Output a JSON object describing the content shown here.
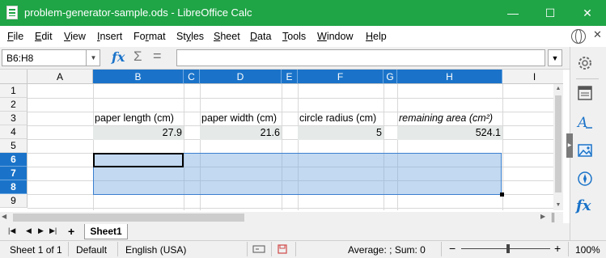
{
  "window": {
    "title": "problem-generator-sample.ods - LibreOffice Calc",
    "minimize": "—",
    "maximize": "☐",
    "close": "✕"
  },
  "menu": {
    "items": [
      {
        "label": "File",
        "accel": "F",
        "rest": "ile"
      },
      {
        "label": "Edit",
        "accel": "E",
        "rest": "dit"
      },
      {
        "label": "View",
        "accel": "V",
        "rest": "iew"
      },
      {
        "label": "Insert",
        "accel": "I",
        "rest": "nsert"
      },
      {
        "label": "Format",
        "accel": "F",
        "rest": "o",
        "accel2": "r",
        "rest2": "mat"
      },
      {
        "label": "Styles",
        "accel": "S",
        "rest": "t",
        "accel2": "y",
        "rest2": "les"
      },
      {
        "label": "Sheet",
        "accel": "S",
        "rest": "heet"
      },
      {
        "label": "Data",
        "accel": "D",
        "rest": "ata"
      },
      {
        "label": "Tools",
        "accel": "T",
        "rest": "ools"
      },
      {
        "label": "Window",
        "accel": "W",
        "rest": "indow"
      },
      {
        "label": "Help",
        "accel": "H",
        "rest": "elp"
      }
    ],
    "close_doc": "✕"
  },
  "formula_bar": {
    "name_box": "B6:H8",
    "formula": "",
    "fx": "fx",
    "sum": "Σ",
    "equals": "="
  },
  "grid": {
    "columns": [
      "A",
      "B",
      "C",
      "D",
      "E",
      "F",
      "G",
      "H",
      "I"
    ],
    "selected_columns": [
      "B",
      "C",
      "D",
      "E",
      "F",
      "G",
      "H"
    ],
    "rows": [
      "1",
      "2",
      "3",
      "4",
      "5",
      "6",
      "7",
      "8",
      "9"
    ],
    "selected_rows": [
      "6",
      "7",
      "8"
    ],
    "cells": {
      "B3": "paper length (cm)",
      "D3": "paper width (cm)",
      "F3": "circle radius (cm)",
      "H3": "remaining area (cm²)",
      "B4": "27.9",
      "D4": "21.6",
      "F4": "5",
      "H4": "524.1"
    }
  },
  "sheet_tabs": {
    "active": "Sheet1",
    "add": "+"
  },
  "status_bar": {
    "sheet_info": "Sheet 1 of 1",
    "page_style": "Default",
    "language": "English (USA)",
    "summary": "Average: ; Sum: 0",
    "zoom": "100%",
    "zoom_minus": "−",
    "zoom_plus": "+"
  },
  "colors": {
    "title_bar": "#1fa446",
    "selection_header": "#1a73c9",
    "selection_fill": "#bcd6f1",
    "label_cell_fill": "#e5e9e8"
  }
}
